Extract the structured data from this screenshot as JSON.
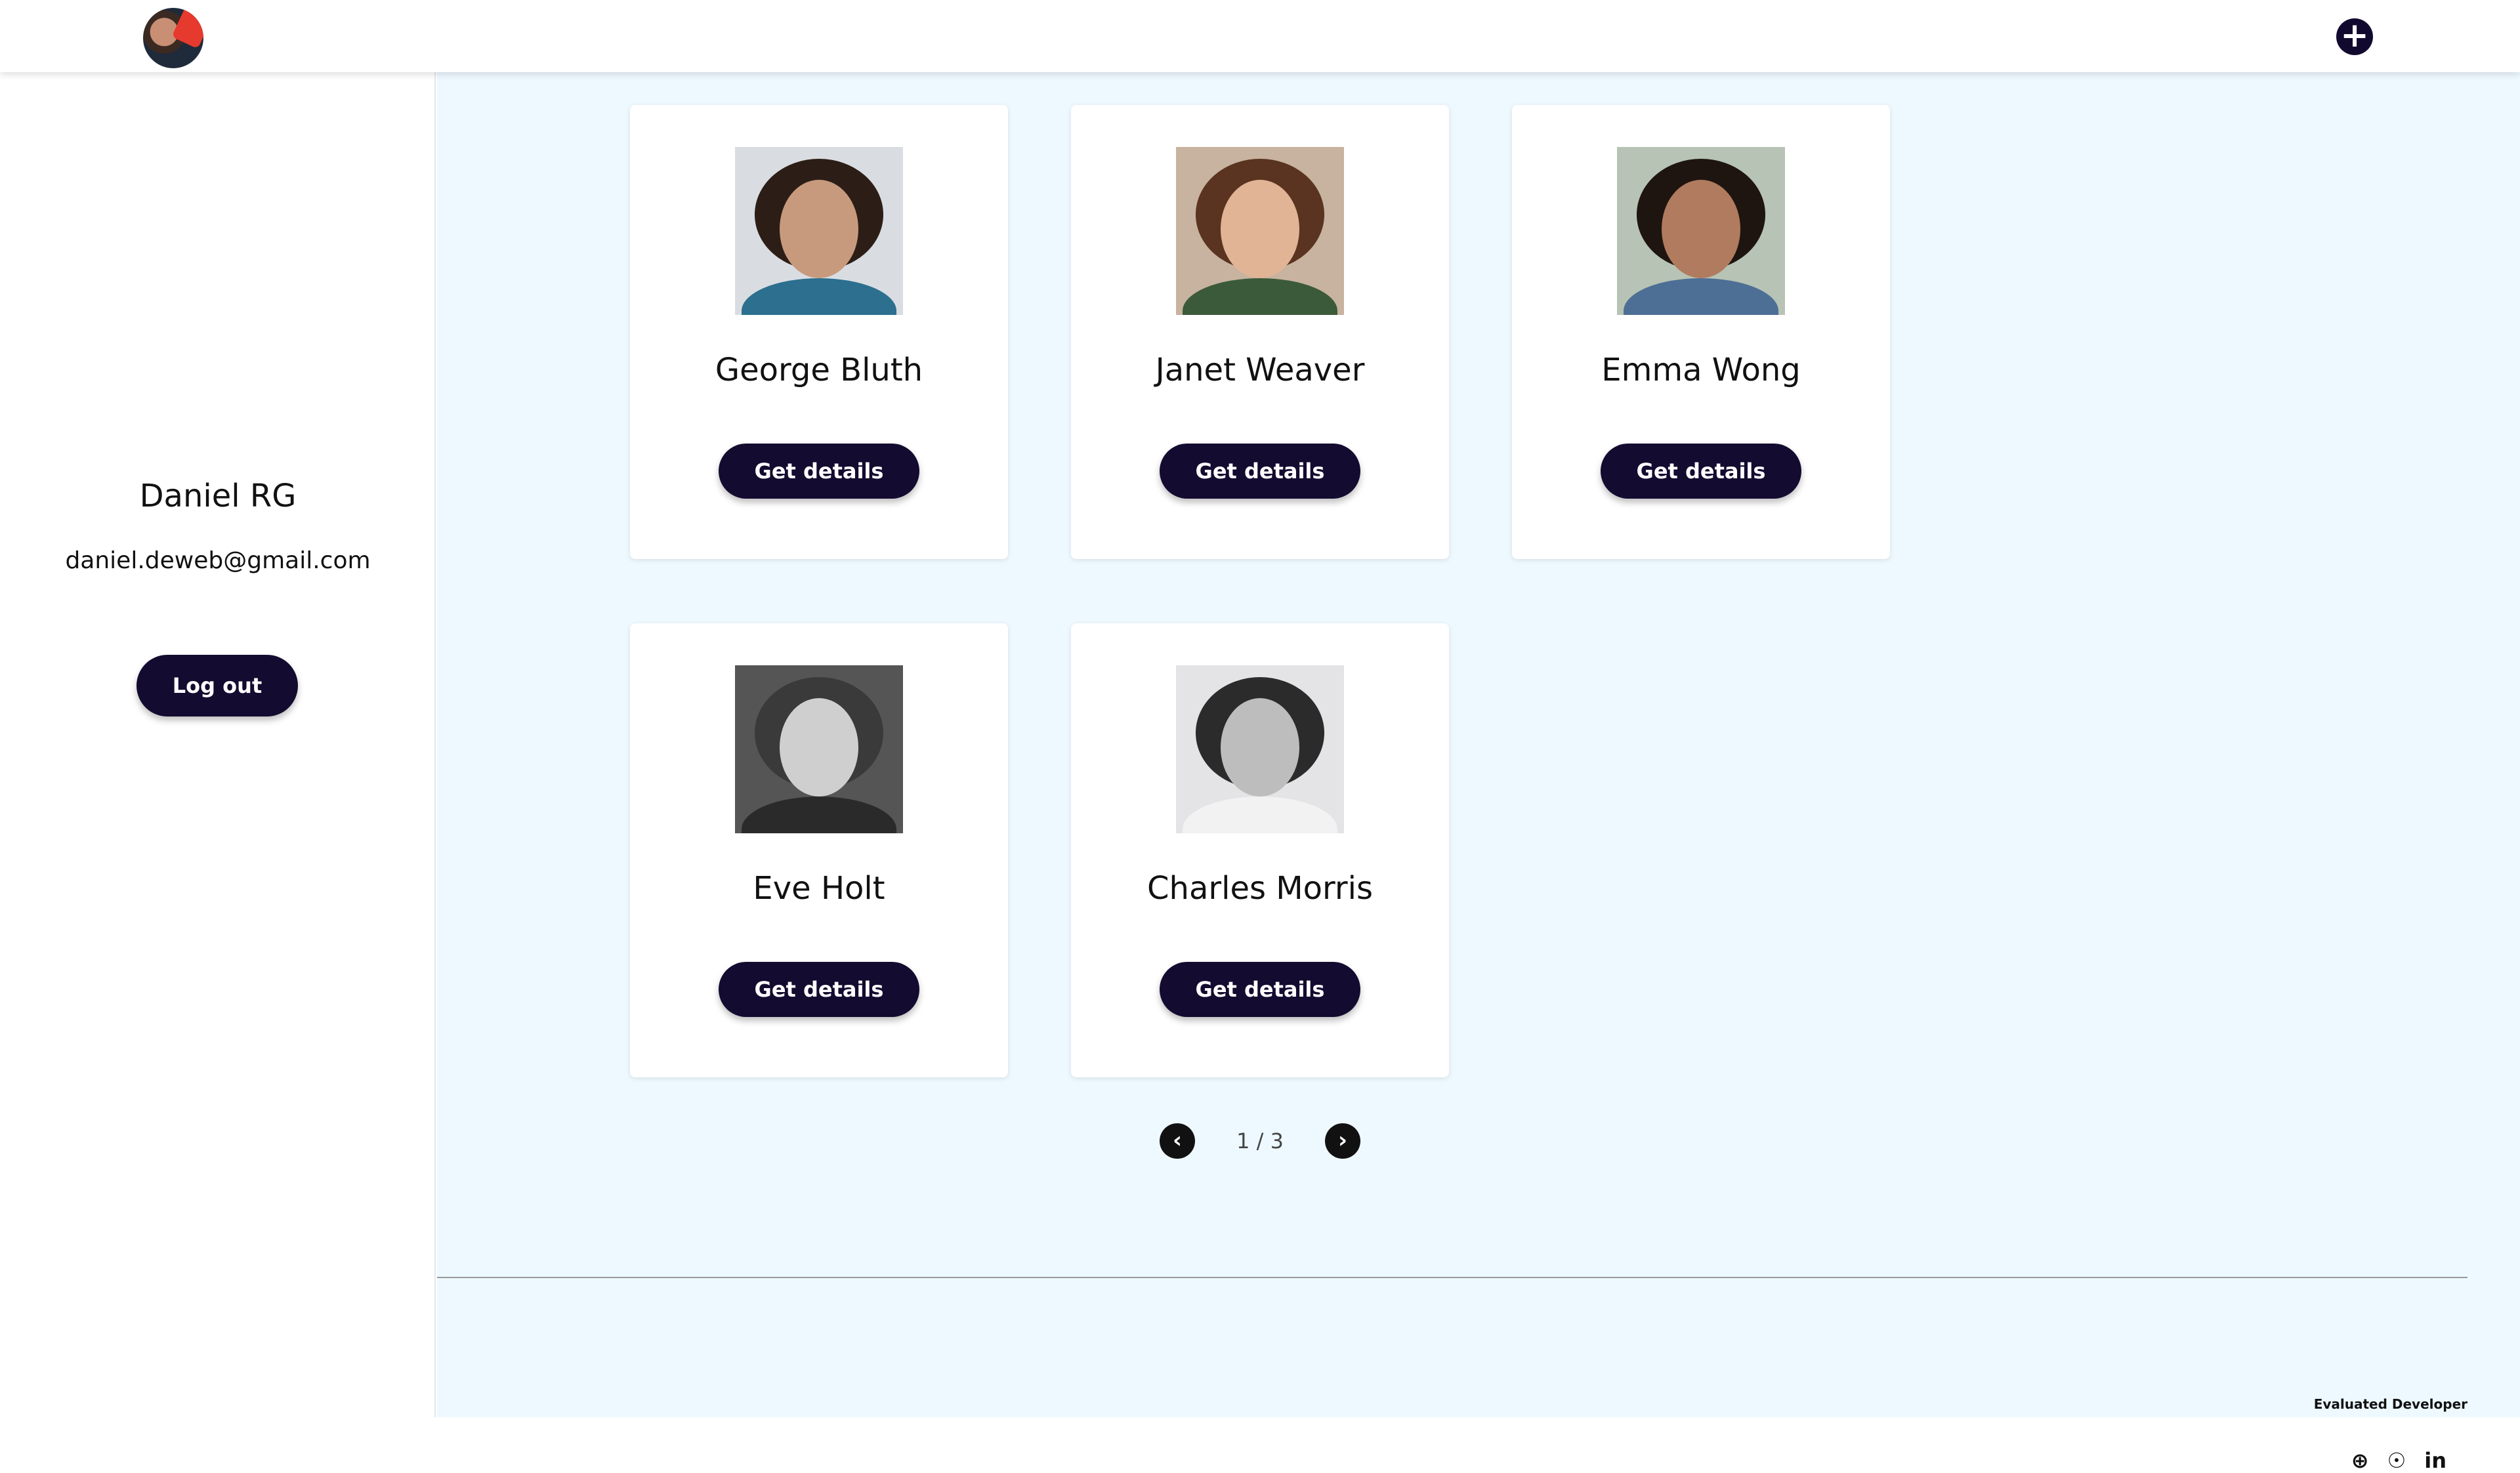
{
  "header": {
    "avatar_icon": "user-avatar-icon",
    "add_icon": "plus-circle-icon",
    "add_symbol": "+"
  },
  "sidebar": {
    "user_name": "Daniel RG",
    "user_email": "daniel.deweb@gmail.com",
    "logout_label": "Log out"
  },
  "users": [
    {
      "name": "George Bluth",
      "button_label": "Get details"
    },
    {
      "name": "Janet Weaver",
      "button_label": "Get details"
    },
    {
      "name": "Emma Wong",
      "button_label": "Get details"
    },
    {
      "name": "Eve Holt",
      "button_label": "Get details"
    },
    {
      "name": "Charles Morris",
      "button_label": "Get details"
    }
  ],
  "pagination": {
    "label": "1 / 3",
    "prev_symbol": "‹",
    "next_symbol": "›"
  },
  "footer": {
    "credit": "Evaluated Developer",
    "icons": [
      {
        "name": "globe-icon",
        "symbol": "⊕"
      },
      {
        "name": "github-icon",
        "symbol": "☉"
      },
      {
        "name": "linkedin-icon",
        "symbol": "in"
      }
    ]
  },
  "colors": {
    "accent": "#140b30",
    "main_bg": "#eef9ff",
    "card_bg": "#ffffff"
  }
}
